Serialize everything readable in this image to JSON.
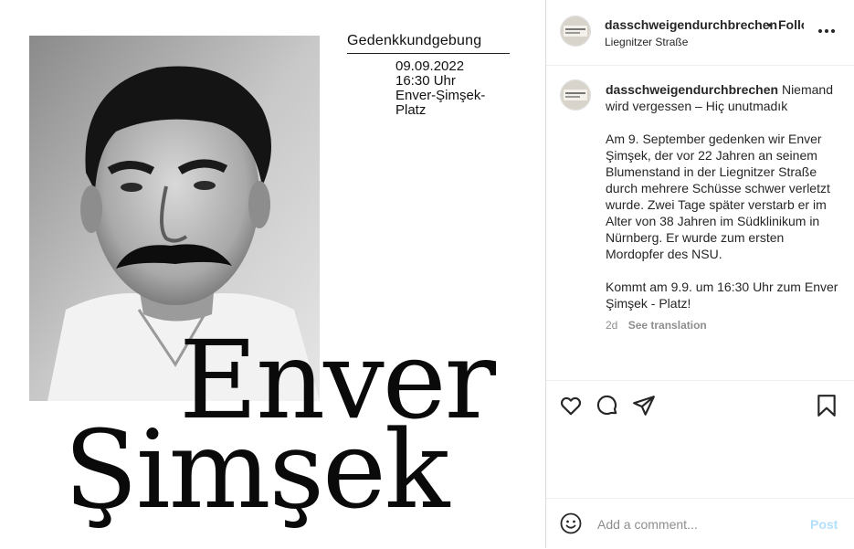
{
  "poster": {
    "event_title": "Gedenkkundgebung",
    "date": "09.09.2022",
    "time": "16:30 Uhr",
    "place_line1": "Enver-Şimşek-",
    "place_line2": "Platz",
    "first_name": "Enver",
    "last_name": "Şimşek"
  },
  "header": {
    "username": "dasschweigendurchbrechen",
    "separator": "•",
    "follow": "Follow",
    "location": "Liegnitzer Straße",
    "more_icon": "more-horizontal-icon"
  },
  "caption": {
    "username": "dasschweigendurchbrechen",
    "headline": "Niemand wird vergessen – Hiç unutmadık",
    "paragraph1": "Am 9. September gedenken wir Enver Şimşek, der vor 22 Jahren an seinem Blumenstand in der Liegnitzer Straße durch mehrere Schüsse schwer verletzt wurde. Zwei Tage später verstarb er im Alter von 38 Jahren im Südklinikum in Nürnberg. Er wurde zum ersten Mordopfer des NSU.",
    "paragraph2": "Kommt am 9.9. um 16:30 Uhr zum Enver Şimşek - Platz!",
    "age": "2d",
    "see_translation": "See translation"
  },
  "actions": {
    "icons": [
      "heart-icon",
      "comment-icon",
      "share-icon",
      "bookmark-icon"
    ]
  },
  "comment": {
    "placeholder": "Add a comment...",
    "post_label": "Post",
    "post_color": "#b2dffc"
  },
  "colors": {
    "text": "#262626",
    "muted": "#8e8e8e",
    "border": "#dbdbdb"
  }
}
